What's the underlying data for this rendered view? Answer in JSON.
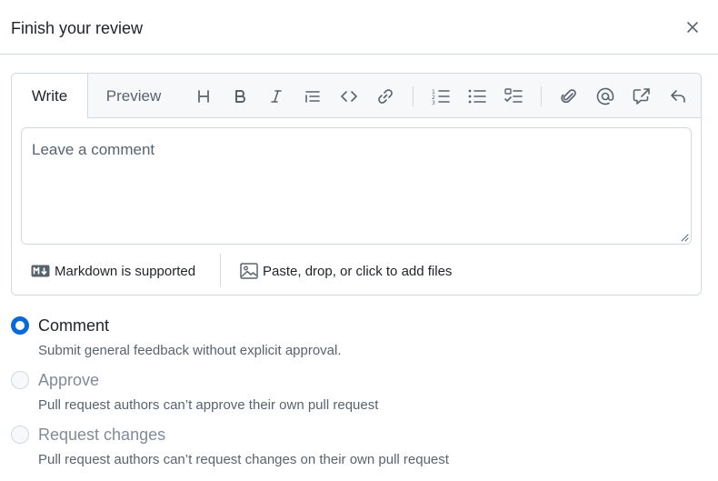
{
  "dialog": {
    "title": "Finish your review"
  },
  "editor": {
    "tabs": {
      "write": "Write",
      "preview": "Preview"
    },
    "toolbar_icons": [
      "heading-icon",
      "bold-icon",
      "italic-icon",
      "quote-icon",
      "code-icon",
      "link-icon",
      "ordered-list-icon",
      "unordered-list-icon",
      "task-list-icon",
      "attach-icon",
      "mention-icon",
      "cross-reference-icon",
      "reply-icon"
    ],
    "placeholder": "Leave a comment",
    "markdown_note": "Markdown is supported",
    "files_note": "Paste, drop, or click to add files"
  },
  "options": [
    {
      "label": "Comment",
      "description": "Submit general feedback without explicit approval.",
      "selected": true,
      "disabled": false
    },
    {
      "label": "Approve",
      "description": "Pull request authors can’t approve their own pull request",
      "selected": false,
      "disabled": true
    },
    {
      "label": "Request changes",
      "description": "Pull request authors can’t request changes on their own pull request",
      "selected": false,
      "disabled": true
    }
  ],
  "colors": {
    "accent": "#0969da",
    "border": "#d1d9e0",
    "muted_text": "#59636e",
    "disabled_text": "#818b98"
  }
}
